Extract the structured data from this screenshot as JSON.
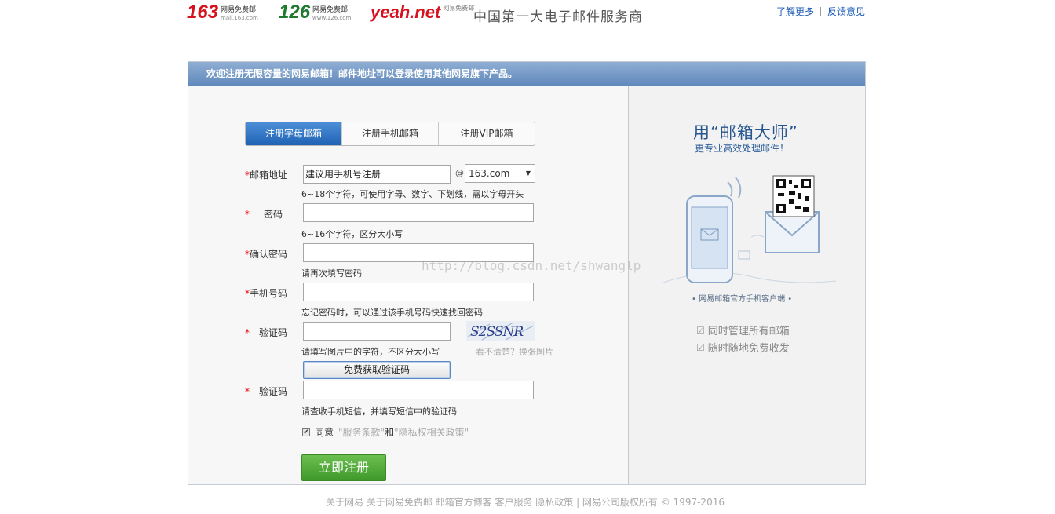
{
  "header": {
    "logos": [
      {
        "name": "163",
        "sub1": "网易免费邮",
        "sub2": "mail.163.com"
      },
      {
        "name": "126",
        "sub1": "网易免费邮",
        "sub2": "www.126.com"
      },
      {
        "name": "yeah.net",
        "sub1": "网易免费邮"
      }
    ],
    "tagline": "中国第一大电子邮件服务商",
    "links": [
      "了解更多",
      "反馈意见"
    ]
  },
  "banner": "欢迎注册无限容量的网易邮箱！邮件地址可以登录使用其他网易旗下产品。",
  "tabs": [
    "注册字母邮箱",
    "注册手机邮箱",
    "注册VIP邮箱"
  ],
  "form": {
    "email": {
      "label": "邮箱地址",
      "value": "建议用手机号注册",
      "at": "@",
      "domain": "163.com",
      "hint": "6~18个字符，可使用字母、数字、下划线，需以字母开头"
    },
    "password": {
      "label": "密码",
      "hint": "6~16个字符，区分大小写"
    },
    "confirm": {
      "label": "确认密码",
      "hint": "请再次填写密码"
    },
    "phone": {
      "label": "手机号码",
      "hint": "忘记密码时，可以通过该手机号码快速找回密码"
    },
    "captcha": {
      "label": "验证码",
      "hint": "请填写图片中的字符，不区分大小写",
      "refresh": "看不清楚？换张图片",
      "image_text": "S2SSNR"
    },
    "sms_button": "免费获取验证码",
    "sms_code": {
      "label": "验证码",
      "hint": "请查收手机短信，并填写短信中的验证码"
    },
    "agree": {
      "prefix": "同意",
      "terms": "\"服务条款\"",
      "and": "和",
      "privacy": "\"隐私权相关政策\""
    },
    "submit": "立即注册"
  },
  "promo": {
    "title": "用“邮箱大师”",
    "subtitle": "更专业高效处理邮件！",
    "caption": "• 网易邮箱官方手机客户端 •",
    "features": [
      "同时管理所有邮箱",
      "随时随地免费收发"
    ]
  },
  "watermark": "http://blog.csdn.net/shwanglp",
  "footer": "关于网易  关于网易免费邮  邮箱官方博客  客户服务  隐私政策  |  网易公司版权所有 © 1997-2016"
}
